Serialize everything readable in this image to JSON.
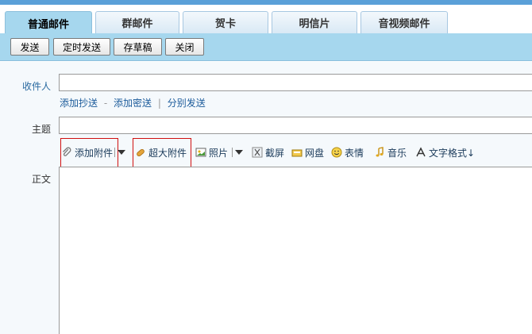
{
  "tabs": [
    {
      "label": "普通邮件",
      "active": true
    },
    {
      "label": "群邮件",
      "active": false
    },
    {
      "label": "贺卡",
      "active": false
    },
    {
      "label": "明信片",
      "active": false
    },
    {
      "label": "音视频邮件",
      "active": false
    }
  ],
  "toolbar": {
    "send_label": "发送",
    "scheduled_send_label": "定时发送",
    "save_draft_label": "存草稿",
    "close_label": "关闭"
  },
  "compose": {
    "to_label": "收件人",
    "to_value": "",
    "add_cc_label": "添加抄送",
    "dash": "-",
    "add_bcc_label": "添加密送",
    "pipe": "|",
    "separate_send_label": "分别发送",
    "subject_label": "主题",
    "subject_value": "",
    "body_label": "正文",
    "body_value": ""
  },
  "attachments": {
    "add_attachment_label": "添加附件",
    "large_attachment_label": "超大附件",
    "photo_label": "照片",
    "screenshot_label": "截屏",
    "netdisk_label": "网盘",
    "emoticon_label": "表情",
    "music_label": "音乐",
    "text_format_label": "文字格式↓"
  },
  "colors": {
    "accent": "#a6d7ee",
    "highlight_box": "#d01010",
    "link": "#1a5a9a"
  },
  "icons": [
    "paperclip-icon",
    "large-attachment-icon",
    "photo-icon",
    "scissors-icon",
    "netdisk-icon",
    "smiley-icon",
    "music-note-icon",
    "text-format-icon",
    "dropdown-caret-icon"
  ]
}
